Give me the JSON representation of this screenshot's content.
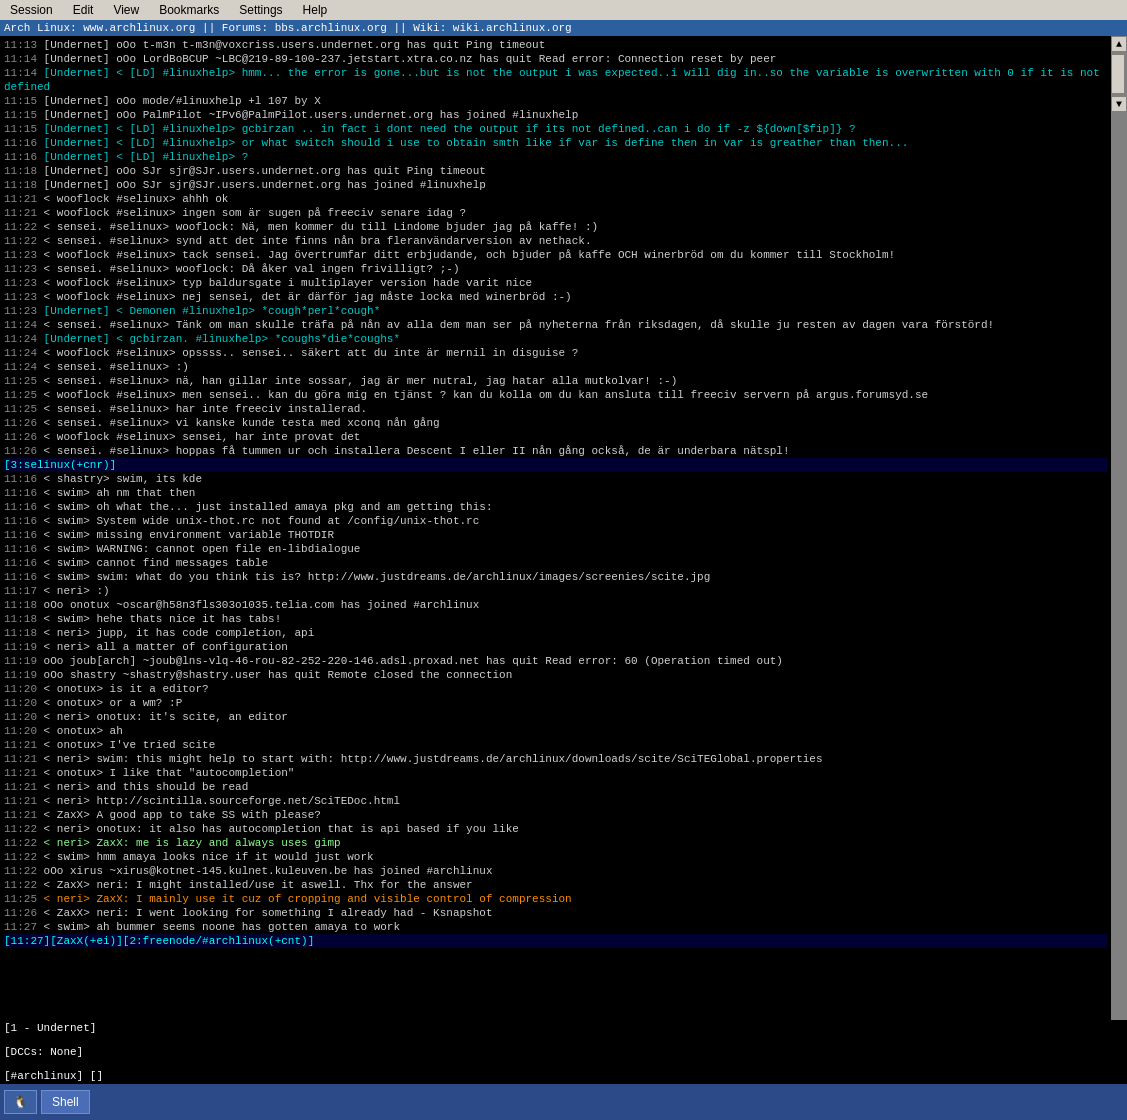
{
  "menu": {
    "items": [
      "Session",
      "Edit",
      "View",
      "Bookmarks",
      "Settings",
      "Help"
    ]
  },
  "title_bar": {
    "text": "Arch Linux: www.archlinux.org || Forums: bbs.archlinux.org || Wiki: wiki.archlinux.org"
  },
  "chat_lines": [
    {
      "time": "11:13",
      "text": "[Undernet] oOo t-m3n t-m3n@voxcriss.users.undernet.org has quit Ping timeout",
      "color": "white"
    },
    {
      "time": "11:14",
      "text": "[Undernet] oOo LordBoBCUP ~LBC@219-89-100-237.jetstart.xtra.co.nz has quit Read error: Connection reset by peer",
      "color": "white"
    },
    {
      "time": "11:14",
      "text": "[Undernet] < [LD] #linuxhelp> hmm... the error is gone...but is not the output i was expected..i will dig in..so the variable is overwritten with 0 if it is not defined",
      "color": "cyan"
    },
    {
      "time": "11:15",
      "text": "[Undernet] oOo mode/#linuxhelp +l 107 by X",
      "color": "white"
    },
    {
      "time": "11:15",
      "text": "[Undernet] oOo PalmPilot ~IPv6@PalmPilot.users.undernet.org has joined #linuxhelp",
      "color": "white"
    },
    {
      "time": "11:15",
      "text": "[Undernet] < [LD] #linuxhelp> gcbirzan .. in fact i dont need the output if its not defined..can i do if -z ${down[$fip]} ?",
      "color": "cyan"
    },
    {
      "time": "11:16",
      "text": "[Undernet] < [LD] #linuxhelp> or what switch should i use to obtain smth like if var is define then in var is greather than then...",
      "color": "cyan"
    },
    {
      "time": "11:16",
      "text": "[Undernet] < [LD] #linuxhelp> ?",
      "color": "cyan"
    },
    {
      "time": "11:18",
      "text": "[Undernet] oOo SJr sjr@SJr.users.undernet.org has quit Ping timeout",
      "color": "white"
    },
    {
      "time": "11:18",
      "text": "[Undernet] oOo SJr sjr@SJr.users.undernet.org has joined #linuxhelp",
      "color": "white"
    },
    {
      "time": "11:21",
      "text": "< wooflock #selinux> ahhh ok",
      "color": "white"
    },
    {
      "time": "11:21",
      "text": "< wooflock #selinux> ingen som är sugen på freeciv senare idag ?",
      "color": "white"
    },
    {
      "time": "11:22",
      "text": "< sensei. #selinux> wooflock: Nä, men kommer du till Lindome bjuder jag på kaffe! :)",
      "color": "white"
    },
    {
      "time": "11:22",
      "text": "< sensei. #selinux> synd att det inte finns nån bra fleranvändarversion av nethack.",
      "color": "white"
    },
    {
      "time": "11:23",
      "text": "< wooflock #selinux> tack sensei. Jag övertrumfar ditt erbjudande, och bjuder på kaffe OCH winerbröd om du kommer till Stockholm!",
      "color": "white"
    },
    {
      "time": "11:23",
      "text": "< sensei. #selinux> wooflock: Då åker val ingen frivilligt? ;-)",
      "color": "white"
    },
    {
      "time": "11:23",
      "text": "< wooflock #selinux> typ baldursgate i multiplayer version hade varit nice",
      "color": "white"
    },
    {
      "time": "11:23",
      "text": "< wooflock #selinux> nej sensei, det är därför jag måste locka med winerbröd :-)",
      "color": "white"
    },
    {
      "time": "11:23",
      "text": "[Undernet] < Demonen #linuxhelp> *cough*perl*cough*",
      "color": "cyan"
    },
    {
      "time": "11:24",
      "text": "< sensei. #selinux> Tänk om man skulle träfa på nån av alla dem man ser på nyheterna från riksdagen, då skulle ju resten av dagen vara förstörd!",
      "color": "white"
    },
    {
      "time": "11:24",
      "text": "[Undernet] < gcbirzan. #linuxhelp> *coughs*die*coughs*",
      "color": "cyan"
    },
    {
      "time": "11:24",
      "text": "< wooflock #selinux> opssss.. sensei.. säkert att du inte är mernil in disguise ?",
      "color": "white"
    },
    {
      "time": "11:24",
      "text": "< sensei. #selinux> :)",
      "color": "white"
    },
    {
      "time": "11:25",
      "text": "< sensei. #selinux> nä, han gillar inte sossar, jag är mer nutral, jag hatar alla mutkolvar! :-)",
      "color": "white"
    },
    {
      "time": "11:25",
      "text": "< wooflock #selinux> men sensei.. kan du göra mig en tjänst ? kan du kolla om du kan ansluta till freeciv servern på argus.forumsyd.se",
      "color": "white"
    },
    {
      "time": "11:25",
      "text": "< sensei. #selinux> har inte freeciv installerad.",
      "color": "white"
    },
    {
      "time": "11:26",
      "text": "< sensei. #selinux> vi kanske kunde testa med xconq nån gång",
      "color": "white"
    },
    {
      "time": "11:26",
      "text": "< wooflock #selinux> sensei, har inte provat det",
      "color": "white"
    },
    {
      "time": "11:26",
      "text": "< sensei. #selinux> hoppas få tummen ur och installera Descent I eller II nån gång också, de är underbara nätspl!",
      "color": "white"
    },
    {
      "time": "",
      "text": "[3:selinux(+cnr)]",
      "color": "cyan",
      "is_section": true
    },
    {
      "time": "11:16",
      "text": "< shastry> swim, its kde",
      "color": "white"
    },
    {
      "time": "11:16",
      "text": "< swim> ah nm that then",
      "color": "white"
    },
    {
      "time": "11:16",
      "text": "< swim> oh what the... just installed amaya pkg and am getting this:",
      "color": "white"
    },
    {
      "time": "11:16",
      "text": "< swim> System wide unix-thot.rc not found at /config/unix-thot.rc",
      "color": "white"
    },
    {
      "time": "11:16",
      "text": "< swim> missing environment variable THOTDIR",
      "color": "white"
    },
    {
      "time": "11:16",
      "text": "< swim> WARNING: cannot open file en-libdialogue",
      "color": "white"
    },
    {
      "time": "11:16",
      "text": "< swim> cannot find messages table",
      "color": "white"
    },
    {
      "time": "11:16",
      "text": "< swim> swim: what do you think tis is? http://www.justdreams.de/archlinux/images/screenies/scite.jpg",
      "color": "white"
    },
    {
      "time": "11:17",
      "text": "< neri> :)",
      "color": "white"
    },
    {
      "time": "11:18",
      "text": "oOo onotux ~oscar@h58n3fls303o1035.telia.com has joined #archlinux",
      "color": "white"
    },
    {
      "time": "11:18",
      "text": "< swim> hehe thats nice it has tabs!",
      "color": "white"
    },
    {
      "time": "11:18",
      "text": "< neri> jupp, it has code completion, api",
      "color": "white"
    },
    {
      "time": "11:19",
      "text": "< neri> all a matter of configuration",
      "color": "white"
    },
    {
      "time": "11:19",
      "text": "oOo joub[arch] ~joub@lns-vlq-46-rou-82-252-220-146.adsl.proxad.net has quit Read error: 60 (Operation timed out)",
      "color": "white"
    },
    {
      "time": "11:19",
      "text": "oOo shastry ~shastry@shastry.user has quit Remote closed the connection",
      "color": "white"
    },
    {
      "time": "11:20",
      "text": "< onotux> is it a editor?",
      "color": "white"
    },
    {
      "time": "11:20",
      "text": "< onotux> or a wm? :P",
      "color": "white"
    },
    {
      "time": "11:20",
      "text": "< neri> onotux: it's scite, an editor",
      "color": "white"
    },
    {
      "time": "11:20",
      "text": "< onotux> ah",
      "color": "white"
    },
    {
      "time": "11:21",
      "text": "< onotux> I've tried scite",
      "color": "white"
    },
    {
      "time": "11:21",
      "text": "< neri> swim: this might help to start with: http://www.justdreams.de/archlinux/downloads/scite/SciTEGlobal.properties",
      "color": "white"
    },
    {
      "time": "11:21",
      "text": "< onotux> I like that \"autocompletion\"",
      "color": "white"
    },
    {
      "time": "11:21",
      "text": "< neri> and this should be read",
      "color": "white"
    },
    {
      "time": "11:21",
      "text": "< neri> http://scintilla.sourceforge.net/SciTEDoc.html",
      "color": "white"
    },
    {
      "time": "11:21",
      "text": "< ZaxX> A good app to take SS with please?",
      "color": "white"
    },
    {
      "time": "11:22",
      "text": "< neri> onotux: it also has autocompletion that is api based if you like",
      "color": "white"
    },
    {
      "time": "11:22",
      "text": "< neri> ZaxX: me is lazy and always uses gimp",
      "color": "lime"
    },
    {
      "time": "11:22",
      "text": "< swim> hmm amaya looks nice if it would just work",
      "color": "white"
    },
    {
      "time": "11:22",
      "text": "oOo xirus ~xirus@kotnet-145.kulnet.kuleuven.be has joined #archlinux",
      "color": "white"
    },
    {
      "time": "11:22",
      "text": "< ZaxX> neri: I might installed/use it aswell. Thx for the answer",
      "color": "white"
    },
    {
      "time": "11:25",
      "text": "< neri> ZaxX: I mainly use it cuz of cropping and visible control of compression",
      "color": "orange"
    },
    {
      "time": "11:26",
      "text": "< ZaxX> neri: I went looking for something I already had - Ksnapshot",
      "color": "white"
    },
    {
      "time": "11:27",
      "text": "< swim> ah bummer seems noone has gotten amaya to work",
      "color": "white"
    },
    {
      "time": "",
      "text": "[11:27][ZaxX(+ei)][2:freenode/#archlinux(+cnt)]",
      "color": "cyan",
      "is_section": true
    }
  ],
  "status_lines": [
    "[1 - Undernet]",
    "[DCCs: None]",
    "[#archlinux] []"
  ],
  "taskbar": {
    "start_label": "🐧",
    "shell_label": "Shell",
    "time": ""
  },
  "scrollbar": {
    "up_arrow": "▲",
    "down_arrow": "▼"
  }
}
